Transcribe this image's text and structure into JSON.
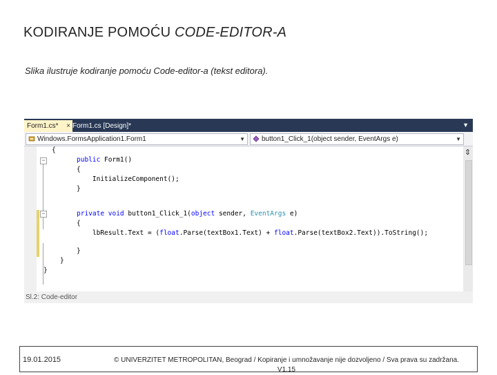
{
  "slide": {
    "title_plain": "KODIRANJE POMOĆU ",
    "title_italic": "CODE-EDITOR-A",
    "subtitle": "Slika ilustruje kodiranje pomoću Code-editor-a (tekst editora).",
    "caption": "Sl.2: Code-editor"
  },
  "editor": {
    "tabs": [
      {
        "label": "Form1.cs*",
        "active": true
      },
      {
        "label": "Form1.cs [Design]*",
        "active": false
      }
    ],
    "tab_close": "×",
    "tab_dropdown": "▼",
    "class_combo": "Windows.FormsApplication1.Form1",
    "member_combo": "button1_Click_1(object sender, EventArgs e)",
    "combo_arrow": "▼",
    "split_glyph": "⇕",
    "code": {
      "l1": "{",
      "l2_kw": "public",
      "l2_rest": " Form1()",
      "l3": "{",
      "l4": "    InitializeComponent();",
      "l5": "}",
      "l6_kw1": "private",
      "l6_kw2": " void",
      "l6_mid": " button1_Click_1(",
      "l6_kw3": "object",
      "l6_mid2": " sender, ",
      "l6_type": "EventArgs",
      "l6_end": " e)",
      "l7": "{",
      "l8_a": "    lbResult.Text = (",
      "l8_kw1": "float",
      "l8_b": ".Parse(textBox1.Text) + ",
      "l8_kw2": "float",
      "l8_c": ".Parse(textBox2.Text)).ToString();",
      "l9": "}",
      "l10": "}",
      "l11": "}"
    },
    "colors": {
      "tabbar": "#293955",
      "active_tab": "#fff4c8",
      "keyword": "#0000ff",
      "type": "#2b91af",
      "change_bar": "#e6d26a"
    }
  },
  "footer": {
    "date": "19.01.2015",
    "copyright": "© UNIVERZITET METROPOLITAN, Beograd / Kopiranje i umnožavanje nije dozvoljeno / Sva prava su zadržana.",
    "version": "V1.15"
  }
}
